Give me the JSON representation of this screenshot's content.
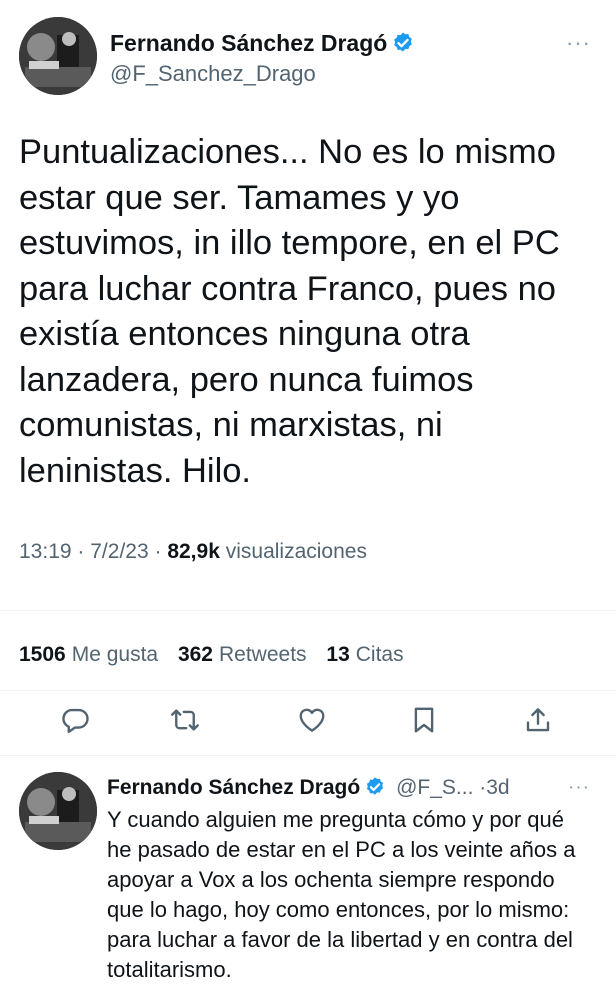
{
  "tweet": {
    "author": {
      "name": "Fernando Sánchez Dragó",
      "handle": "@F_Sanchez_Drago"
    },
    "more_label": "···",
    "text": "Puntualizaciones... No es lo mismo estar que ser. Tamames y yo estuvimos, in illo tempore, en el PC para luchar contra Franco, pues no existía entonces ninguna otra lanzadera, pero nunca fuimos comunistas, ni marxistas, ni leninistas. Hilo.",
    "time": "13:19",
    "date": "7/2/23",
    "separator": "·",
    "views_count": "82,9k",
    "views_label": "visualizaciones",
    "stats": {
      "likes_count": "1506",
      "likes_label": "Me gusta",
      "retweets_count": "362",
      "retweets_label": "Retweets",
      "quotes_count": "13",
      "quotes_label": "Citas"
    },
    "actions": [
      "reply-icon",
      "retweet-icon",
      "like-icon",
      "bookmark-icon",
      "share-icon"
    ]
  },
  "reply": {
    "author": {
      "name": "Fernando Sánchez Dragó",
      "handle": "@F_S...",
      "age": "3d"
    },
    "separator": "·",
    "more_label": "···",
    "text": "Y cuando alguien me pregunta cómo y por qué he pasado de estar en el PC a los veinte años a apoyar a Vox a los ochenta siempre respondo que lo hago, hoy como entonces, por lo mismo: para luchar a favor de la libertad y en contra del totalitarismo."
  },
  "colors": {
    "verified": "#1d9bf0",
    "secondary_text": "#536471",
    "primary_text": "#0f1419",
    "divider": "#eff3f4"
  }
}
